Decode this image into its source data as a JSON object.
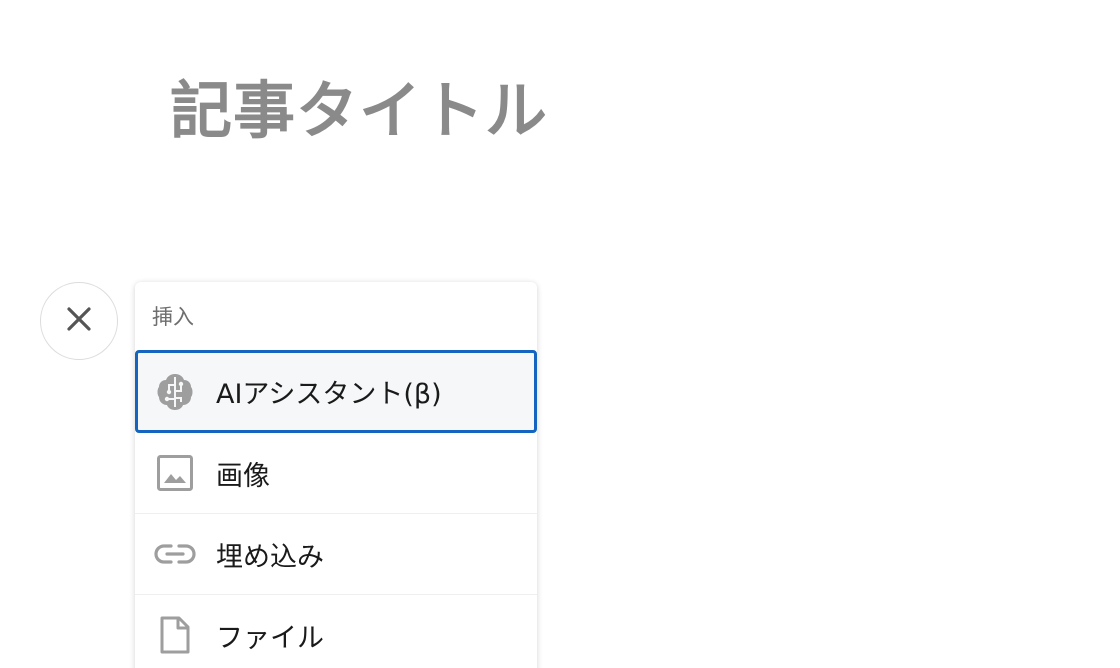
{
  "article": {
    "title": "記事タイトル"
  },
  "insert_menu": {
    "heading": "挿入",
    "items": [
      {
        "label": "AIアシスタント(β)",
        "icon": "brain-icon",
        "highlighted": true
      },
      {
        "label": "画像",
        "icon": "image-icon"
      },
      {
        "label": "埋め込み",
        "icon": "link-icon"
      },
      {
        "label": "ファイル",
        "icon": "file-icon"
      }
    ]
  },
  "colors": {
    "title_text": "#8a8a8a",
    "focus_border": "#1565c0",
    "icon_gray": "#9e9e9e"
  }
}
